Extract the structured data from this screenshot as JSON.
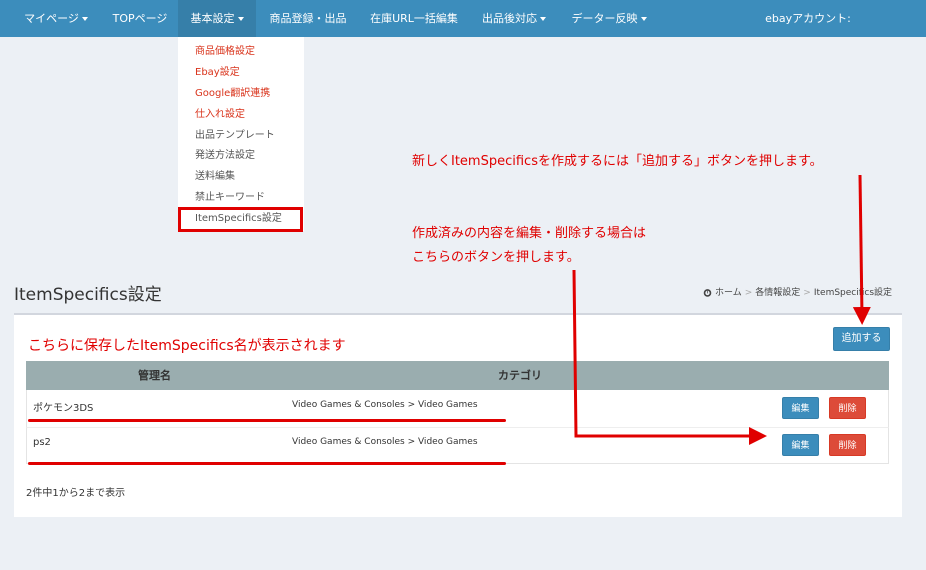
{
  "navbar": {
    "items": [
      {
        "label": "マイページ",
        "caret": true
      },
      {
        "label": "TOPページ",
        "caret": false
      },
      {
        "label": "基本設定",
        "caret": true
      },
      {
        "label": "商品登録・出品",
        "caret": false
      },
      {
        "label": "在庫URL一括編集",
        "caret": false
      },
      {
        "label": "出品後対応",
        "caret": true
      },
      {
        "label": "データー反映",
        "caret": true
      }
    ],
    "account_label": "ebayアカウント:",
    "color": "#3c8dbc"
  },
  "dropdown": {
    "items": [
      {
        "label": "商品価格設定"
      },
      {
        "label": "Ebay設定"
      },
      {
        "label": "Google翻訳連携"
      },
      {
        "label": "仕入れ設定"
      },
      {
        "label": "出品テンプレート"
      },
      {
        "label": "発送方法設定"
      },
      {
        "label": "送料編集"
      },
      {
        "label": "禁止キーワード"
      },
      {
        "label": "ItemSpecifics設定"
      }
    ]
  },
  "annotations": {
    "add_note": "新しくItemSpecificsを作成するには「追加する」ボタンを押します。",
    "edit_note_line1": "作成済みの内容を編集・削除する場合は",
    "edit_note_line2": "こちらのボタンを押します。",
    "list_note": "こちらに保存したItemSpecifics名が表示されます",
    "color": "#e00000"
  },
  "page": {
    "title": "ItemSpecifics設定",
    "breadcrumb": [
      "ホーム",
      "各情報設定",
      "ItemSpecifics設定"
    ]
  },
  "box": {
    "add_button": "追加する",
    "columns": [
      "管理名",
      "カテゴリ"
    ],
    "rows": [
      {
        "name": "ポケモン3DS",
        "category": "Video Games & Consoles > Video Games",
        "edit": "編集",
        "delete": "削除"
      },
      {
        "name": "ps2",
        "category": "Video Games & Consoles > Video Games",
        "edit": "編集",
        "delete": "削除"
      }
    ],
    "summary": "2件中1から2まで表示"
  }
}
